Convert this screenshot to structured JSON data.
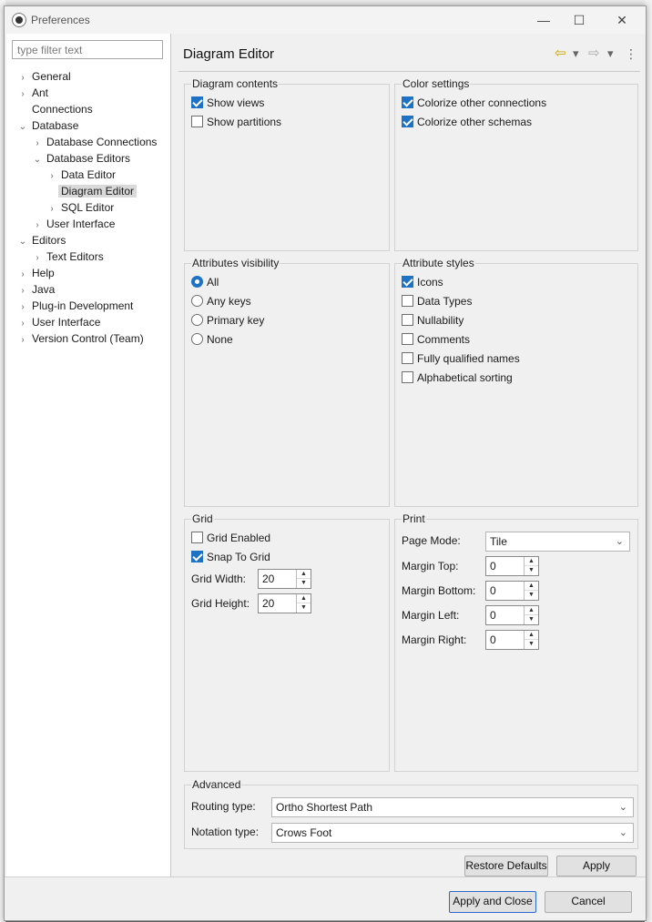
{
  "window": {
    "title": "Preferences",
    "minimize_glyph": "—",
    "maximize_glyph": "☐",
    "close_glyph": "✕"
  },
  "filter": {
    "placeholder": "type filter text",
    "value": ""
  },
  "tree": [
    {
      "label": "General",
      "arrow": "›"
    },
    {
      "label": "Ant",
      "arrow": "›"
    },
    {
      "label": "Connections",
      "arrow": ""
    },
    {
      "label": "Database",
      "arrow": "⌄"
    },
    {
      "label": "Database Connections",
      "arrow": "›"
    },
    {
      "label": "Database Editors",
      "arrow": "⌄"
    },
    {
      "label": "Data Editor",
      "arrow": "›"
    },
    {
      "label": "Diagram Editor",
      "arrow": "",
      "selected": true
    },
    {
      "label": "SQL Editor",
      "arrow": "›"
    },
    {
      "label": "User Interface",
      "arrow": "›"
    },
    {
      "label": "Editors",
      "arrow": "⌄"
    },
    {
      "label": "Text Editors",
      "arrow": "›"
    },
    {
      "label": "Help",
      "arrow": "›"
    },
    {
      "label": "Java",
      "arrow": "›"
    },
    {
      "label": "Plug-in Development",
      "arrow": "›"
    },
    {
      "label": "User Interface",
      "arrow": "›"
    },
    {
      "label": "Version Control (Team)",
      "arrow": "›"
    }
  ],
  "page": {
    "title": "Diagram Editor",
    "nav": {
      "back_glyph": "⇦",
      "forward_glyph": "⇨",
      "dropdown_glyph": "▾",
      "menu_glyph": "⋮"
    }
  },
  "diagram_contents": {
    "label": "Diagram contents",
    "options": [
      {
        "label": "Show views",
        "checked": true
      },
      {
        "label": "Show partitions",
        "checked": false
      }
    ]
  },
  "color_settings": {
    "label": "Color settings",
    "options": [
      {
        "label": "Colorize other connections",
        "checked": true
      },
      {
        "label": "Colorize other schemas",
        "checked": true
      }
    ]
  },
  "attributes_visibility": {
    "label": "Attributes visibility",
    "options": [
      {
        "label": "All",
        "checked": true
      },
      {
        "label": "Any keys",
        "checked": false
      },
      {
        "label": "Primary key",
        "checked": false
      },
      {
        "label": "None",
        "checked": false
      }
    ]
  },
  "attribute_styles": {
    "label": "Attribute styles",
    "options": [
      {
        "label": "Icons",
        "checked": true
      },
      {
        "label": "Data Types",
        "checked": false
      },
      {
        "label": "Nullability",
        "checked": false
      },
      {
        "label": "Comments",
        "checked": false
      },
      {
        "label": "Fully qualified names",
        "checked": false
      },
      {
        "label": "Alphabetical sorting",
        "checked": false
      }
    ]
  },
  "grid": {
    "label": "Grid",
    "grid_enabled": {
      "label": "Grid Enabled",
      "checked": false
    },
    "snap_to_grid": {
      "label": "Snap To Grid",
      "checked": true
    },
    "width": {
      "label": "Grid Width:",
      "value": "20"
    },
    "height": {
      "label": "Grid Height:",
      "value": "20"
    }
  },
  "print": {
    "label": "Print",
    "page_mode": {
      "label": "Page Mode:",
      "value": "Tile"
    },
    "margins": [
      {
        "label": "Margin Top:",
        "value": "0"
      },
      {
        "label": "Margin Bottom:",
        "value": "0"
      },
      {
        "label": "Margin Left:",
        "value": "0"
      },
      {
        "label": "Margin Right:",
        "value": "0"
      }
    ]
  },
  "advanced": {
    "label": "Advanced",
    "routing": {
      "label": "Routing type:",
      "value": "Ortho Shortest Path"
    },
    "notation": {
      "label": "Notation type:",
      "value": "Crows Foot"
    }
  },
  "buttons": {
    "restore_defaults": "Restore Defaults",
    "apply": "Apply",
    "apply_and_close": "Apply and Close",
    "cancel": "Cancel"
  },
  "colors": {
    "accent": "#1d72c6",
    "default_button_border": "#2a6ad0",
    "selection": "#d9d9d9"
  }
}
